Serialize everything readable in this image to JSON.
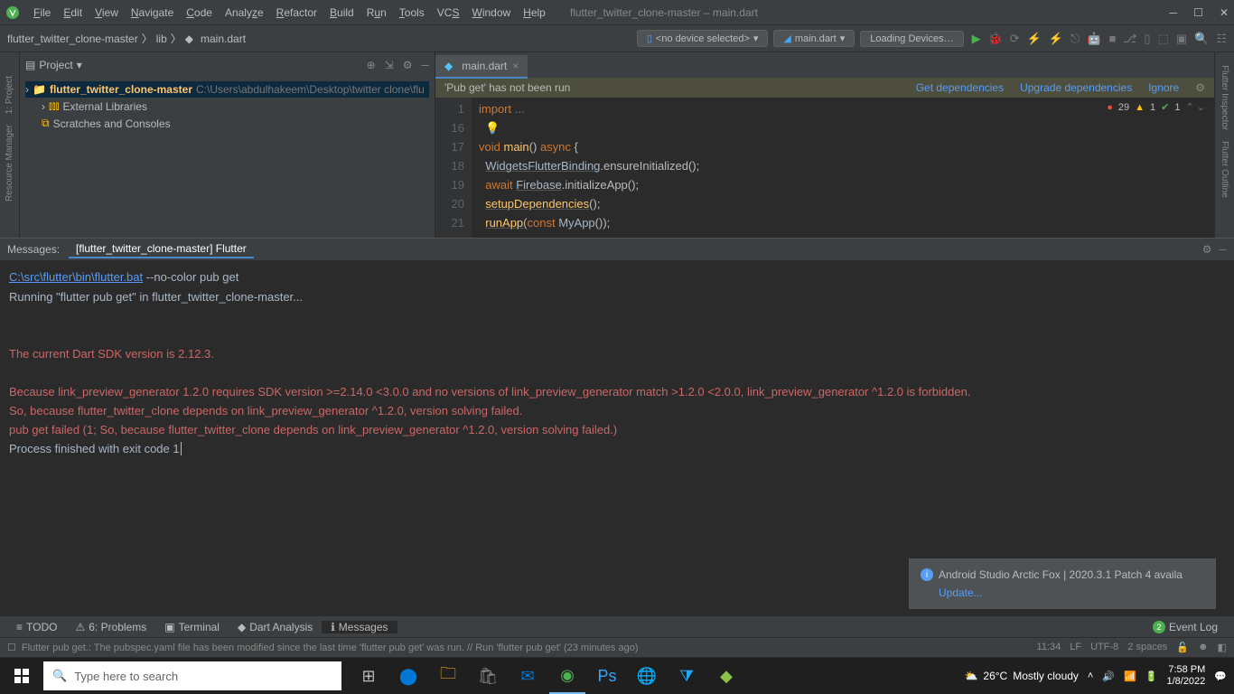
{
  "menus": [
    "File",
    "Edit",
    "View",
    "Navigate",
    "Code",
    "Analyze",
    "Refactor",
    "Build",
    "Run",
    "Tools",
    "VCS",
    "Window",
    "Help"
  ],
  "window_title": "flutter_twitter_clone-master – main.dart",
  "breadcrumb": {
    "project": "flutter_twitter_clone-master",
    "folder": "lib",
    "file": "main.dart"
  },
  "device_selector": "<no device selected>",
  "run_config": "main.dart",
  "loading_devices": "Loading Devices…",
  "project_pane": {
    "title": "Project",
    "root": "flutter_twitter_clone-master",
    "root_path": "C:\\Users\\abdulhakeem\\Desktop\\twitter clone\\flu",
    "ext_libs": "External Libraries",
    "scratches": "Scratches and Consoles"
  },
  "editor": {
    "tab": "main.dart",
    "banner_text": "'Pub get' has not been run",
    "links": {
      "get": "Get dependencies",
      "upgrade": "Upgrade dependencies",
      "ignore": "Ignore"
    },
    "lines": {
      "l1": "1",
      "l16": "16",
      "l17": "17",
      "l18": "18",
      "l19": "19",
      "l20": "20",
      "l21": "21"
    },
    "status": {
      "errors": "29",
      "warnings": "1",
      "ok": "1"
    }
  },
  "messages": {
    "label": "Messages:",
    "tab": "[flutter_twitter_clone-master] Flutter",
    "cmd_path": "C:\\src\\flutter\\bin\\flutter.bat",
    "cmd_args": " --no-color pub get",
    "running": "Running \"flutter pub get\" in flutter_twitter_clone-master...",
    "sdk_line": "The current Dart SDK version is 2.12.3.",
    "err1": "Because link_preview_generator 1.2.0 requires SDK version >=2.14.0 <3.0.0 and no versions of link_preview_generator match >1.2.0 <2.0.0, link_preview_generator ^1.2.0 is forbidden.",
    "err2": "So, because flutter_twitter_clone depends on link_preview_generator ^1.2.0, version solving failed.",
    "err3": "pub get failed (1; So, because flutter_twitter_clone depends on link_preview_generator ^1.2.0, version solving failed.)",
    "exit": "Process finished with exit code 1"
  },
  "popup": {
    "title": "Android Studio Arctic Fox | 2020.3.1 Patch 4 availa",
    "link": "Update..."
  },
  "bottom_tabs": {
    "todo": "TODO",
    "problems": "6: Problems",
    "terminal": "Terminal",
    "dart": "Dart Analysis",
    "messages": "Messages",
    "event_log": "Event Log",
    "event_count": "2"
  },
  "statusbar": {
    "text": "Flutter pub get.: The pubspec.yaml file has been modified since the last time 'flutter pub get' was run. // Run 'flutter pub get' (23 minutes ago)",
    "pos": "11:34",
    "lf": "LF",
    "enc": "UTF-8",
    "indent": "2 spaces"
  },
  "taskbar": {
    "search_placeholder": "Type here to search",
    "weather": {
      "temp": "26°C",
      "desc": "Mostly cloudy"
    },
    "time": "7:58 PM",
    "date": "1/8/2022"
  }
}
